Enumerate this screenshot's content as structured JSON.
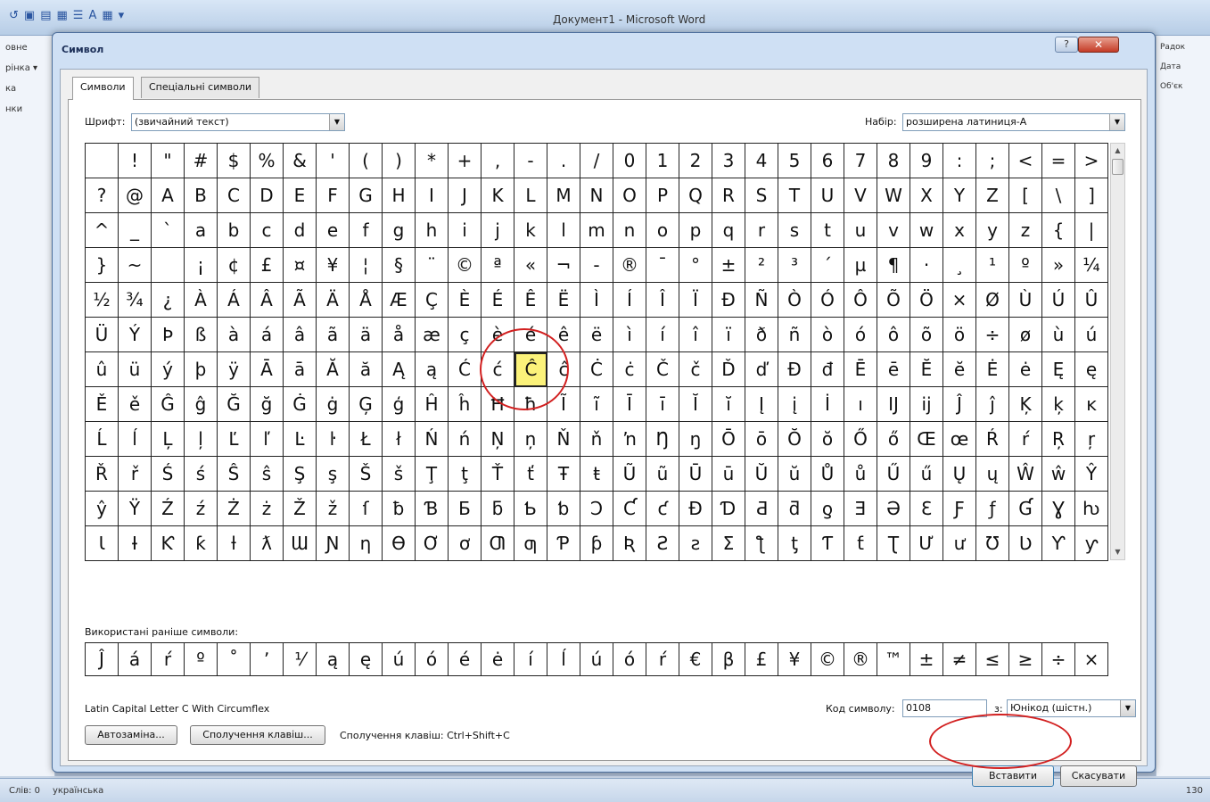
{
  "word": {
    "title": "Документ1 - Microsoft Word",
    "left_items": [
      "овне",
      "рінка ▾",
      "ка",
      "нки"
    ],
    "right_items": [
      "Радок",
      "Дата",
      "Об'єк"
    ],
    "status": {
      "words": "Слів: 0",
      "language": "українська",
      "zoom": "130"
    }
  },
  "dialog": {
    "title": "Символ",
    "help": "?",
    "close": "✕",
    "tabs": {
      "symbols": "Символи",
      "special": "Спеціальні символи"
    },
    "font_label": "Шрифт:",
    "font_value": "(звичайний текст)",
    "subset_label": "Набір:",
    "subset_value": "розширена латиниця-A",
    "symbol_rows": [
      [
        " ",
        "!",
        "\"",
        "#",
        "$",
        "%",
        "&",
        "'",
        "(",
        ")",
        "*",
        "+",
        ",",
        "-",
        ".",
        "/",
        "0",
        "1",
        "2",
        "3",
        "4",
        "5",
        "6",
        "7",
        "8",
        "9",
        ":",
        ";",
        "<",
        "=",
        ">"
      ],
      [
        "?",
        "@",
        "A",
        "B",
        "C",
        "D",
        "E",
        "F",
        "G",
        "H",
        "I",
        "J",
        "K",
        "L",
        "M",
        "N",
        "O",
        "P",
        "Q",
        "R",
        "S",
        "T",
        "U",
        "V",
        "W",
        "X",
        "Y",
        "Z",
        "[",
        "\\",
        "]"
      ],
      [
        "^",
        "_",
        "`",
        "a",
        "b",
        "c",
        "d",
        "e",
        "f",
        "g",
        "h",
        "i",
        "j",
        "k",
        "l",
        "m",
        "n",
        "o",
        "p",
        "q",
        "r",
        "s",
        "t",
        "u",
        "v",
        "w",
        "x",
        "y",
        "z",
        "{",
        "|"
      ],
      [
        "}",
        "~",
        " ",
        "¡",
        "¢",
        "£",
        "¤",
        "¥",
        "¦",
        "§",
        "¨",
        "©",
        "ª",
        "«",
        "¬",
        "-",
        "®",
        "¯",
        "°",
        "±",
        "²",
        "³",
        "´",
        "µ",
        "¶",
        "·",
        "¸",
        "¹",
        "º",
        "»",
        "¼"
      ],
      [
        "½",
        "¾",
        "¿",
        "À",
        "Á",
        "Â",
        "Ã",
        "Ä",
        "Å",
        "Æ",
        "Ç",
        "È",
        "É",
        "Ê",
        "Ë",
        "Ì",
        "Í",
        "Î",
        "Ï",
        "Ð",
        "Ñ",
        "Ò",
        "Ó",
        "Ô",
        "Õ",
        "Ö",
        "×",
        "Ø",
        "Ù",
        "Ú",
        "Û"
      ],
      [
        "Ü",
        "Ý",
        "Þ",
        "ß",
        "à",
        "á",
        "â",
        "ã",
        "ä",
        "å",
        "æ",
        "ç",
        "è",
        "é",
        "ê",
        "ë",
        "ì",
        "í",
        "î",
        "ï",
        "ð",
        "ñ",
        "ò",
        "ó",
        "ô",
        "õ",
        "ö",
        "÷",
        "ø",
        "ù",
        "ú"
      ],
      [
        "û",
        "ü",
        "ý",
        "þ",
        "ÿ",
        "Ā",
        "ā",
        "Ă",
        "ă",
        "Ą",
        "ą",
        "Ć",
        "ć",
        "Ĉ",
        "ĉ",
        "Ċ",
        "ċ",
        "Č",
        "č",
        "Ď",
        "ď",
        "Đ",
        "đ",
        "Ē",
        "ē",
        "Ĕ",
        "ĕ",
        "Ė",
        "ė",
        "Ę",
        "ę"
      ],
      [
        "Ě",
        "ě",
        "Ĝ",
        "ĝ",
        "Ğ",
        "ğ",
        "Ġ",
        "ġ",
        "Ģ",
        "ģ",
        "Ĥ",
        "ĥ",
        "Ħ",
        "ħ",
        "Ĩ",
        "ĩ",
        "Ī",
        "ī",
        "Ĭ",
        "ĭ",
        "Į",
        "į",
        "İ",
        "ı",
        "Ĳ",
        "ĳ",
        "Ĵ",
        "ĵ",
        "Ķ",
        "ķ",
        "ĸ"
      ],
      [
        "Ĺ",
        "ĺ",
        "Ļ",
        "ļ",
        "Ľ",
        "ľ",
        "Ŀ",
        "ŀ",
        "Ł",
        "ł",
        "Ń",
        "ń",
        "Ņ",
        "ņ",
        "Ň",
        "ň",
        "ŉ",
        "Ŋ",
        "ŋ",
        "Ō",
        "ō",
        "Ŏ",
        "ŏ",
        "Ő",
        "ő",
        "Œ",
        "œ",
        "Ŕ",
        "ŕ",
        "Ŗ",
        "ŗ"
      ],
      [
        "Ř",
        "ř",
        "Ś",
        "ś",
        "Ŝ",
        "ŝ",
        "Ş",
        "ş",
        "Š",
        "š",
        "Ţ",
        "ţ",
        "Ť",
        "ť",
        "Ŧ",
        "ŧ",
        "Ũ",
        "ũ",
        "Ū",
        "ū",
        "Ŭ",
        "ŭ",
        "Ů",
        "ů",
        "Ű",
        "ű",
        "Ų",
        "ų",
        "Ŵ",
        "ŵ",
        "Ŷ"
      ],
      [
        "ŷ",
        "Ÿ",
        "Ź",
        "ź",
        "Ż",
        "ż",
        "Ž",
        "ž",
        "ſ",
        "ƀ",
        "Ɓ",
        "Ƃ",
        "ƃ",
        "Ƅ",
        "ƅ",
        "Ɔ",
        "Ƈ",
        "ƈ",
        "Ɖ",
        "Ɗ",
        "Ƌ",
        "ƌ",
        "ƍ",
        "Ǝ",
        "Ə",
        "Ɛ",
        "Ƒ",
        "ƒ",
        "Ɠ",
        "Ɣ",
        "ƕ"
      ],
      [
        "Ɩ",
        "Ɨ",
        "Ƙ",
        "ƙ",
        "ƚ",
        "ƛ",
        "Ɯ",
        "Ɲ",
        "ƞ",
        "Ɵ",
        "Ơ",
        "ơ",
        "Ƣ",
        "ƣ",
        "Ƥ",
        "ƥ",
        "Ʀ",
        "Ƨ",
        "ƨ",
        "Ʃ",
        "ƪ",
        "ƫ",
        "Ƭ",
        "ƭ",
        "Ʈ",
        "Ư",
        "ư",
        "Ʊ",
        "Ʋ",
        "Ƴ",
        "ƴ"
      ]
    ],
    "selected": {
      "row": 6,
      "col": 13
    },
    "recent_label": "Використані раніше символи:",
    "recent_symbols": [
      "Ĵ",
      "á",
      "ŕ",
      "º",
      "˚",
      "ʼ",
      "⅟",
      "ą",
      "ę",
      "ú",
      "ó",
      "é",
      "ė",
      "í",
      "ĺ",
      "ú",
      "ó",
      "ŕ",
      "€",
      "β",
      "£",
      "¥",
      "©",
      "®",
      "™",
      "±",
      "≠",
      "≤",
      "≥",
      "÷",
      "×"
    ],
    "char_name": "Latin Capital Letter C With Circumflex",
    "code_label": "Код символу:",
    "code_value": "0108",
    "from_label": "з:",
    "from_value": "Юнікод (шістн.)",
    "autocorrect_btn": "Автозаміна...",
    "shortcut_btn": "Сполучення клавіш...",
    "shortcut_text": "Сполучення клавіш: Ctrl+Shift+C",
    "insert_btn": "Вставити",
    "cancel_btn": "Скасувати",
    "accent_color": "#fbf27a",
    "highlight_color": "#d22020"
  }
}
